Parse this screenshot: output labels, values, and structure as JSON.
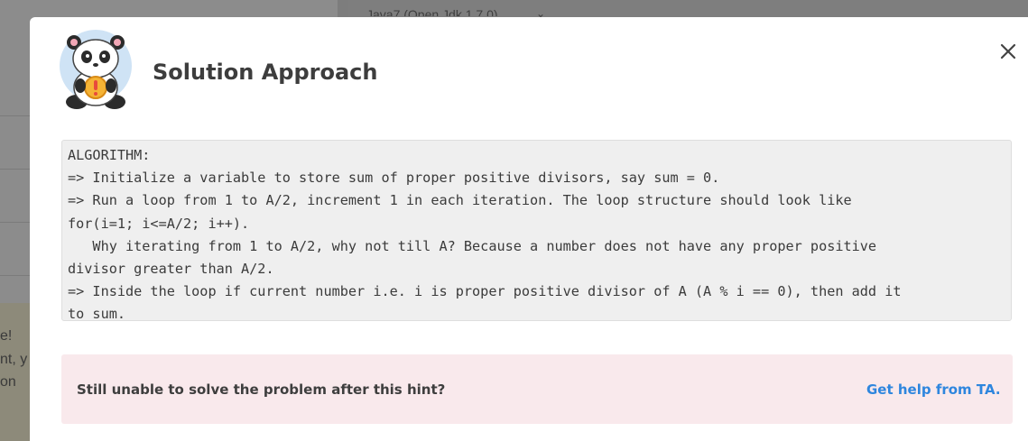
{
  "background": {
    "language_selector": "Java7 (Open Jdk 1.7.0)",
    "notice_fragments": [
      "e!",
      "nt, y",
      "on"
    ]
  },
  "modal": {
    "title": "Solution Approach",
    "close_icon": "close-icon",
    "avatar_icon": "panda-mascot-icon",
    "code_lines": [
      "ALGORITHM:",
      "=> Initialize a variable to store sum of proper positive divisors, say sum = 0.",
      "=> Run a loop from 1 to A/2, increment 1 in each iteration. The loop structure should look like",
      "for(i=1; i<=A/2; i++).",
      "   Why iterating from 1 to A/2, why not till A? Because a number does not have any proper positive",
      "divisor greater than A/2.",
      "=> Inside the loop if current number i.e. i is proper positive divisor of A (A % i == 0), then add it",
      "to sum."
    ],
    "hint": {
      "text": "Still unable to solve the problem after this hint?",
      "link": "Get help from TA."
    }
  },
  "colors": {
    "overlay": "#8a8a8a",
    "hint_bg": "#f9e9ec",
    "link": "#2e86de",
    "code_bg": "#efefef"
  }
}
